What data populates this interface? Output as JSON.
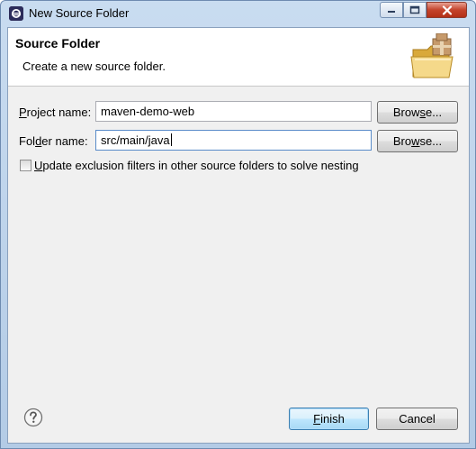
{
  "window": {
    "title": "New Source Folder",
    "minimize_label": "minimize",
    "maximize_label": "maximize",
    "close_label": "close"
  },
  "header": {
    "title": "Source Folder",
    "description": "Create a new source folder."
  },
  "form": {
    "project_label_pre": "",
    "project_label_mn": "P",
    "project_label_post": "roject name:",
    "project_value": "maven-demo-web",
    "project_browse_pre": "Brow",
    "project_browse_mn": "s",
    "project_browse_post": "e...",
    "folder_label_pre": "Fol",
    "folder_label_mn": "d",
    "folder_label_post": "er name:",
    "folder_value": "src/main/java",
    "folder_browse_pre": "Bro",
    "folder_browse_mn": "w",
    "folder_browse_post": "se...",
    "checkbox_label_pre": "",
    "checkbox_label_mn": "U",
    "checkbox_label_post": "pdate exclusion filters in other source folders to solve nesting",
    "checkbox_checked": false
  },
  "footer": {
    "finish_mn": "F",
    "finish_post": "inish",
    "cancel_label": "Cancel"
  },
  "icons": {
    "app": "eclipse-icon",
    "header": "folder-package-icon",
    "help": "help-icon"
  }
}
